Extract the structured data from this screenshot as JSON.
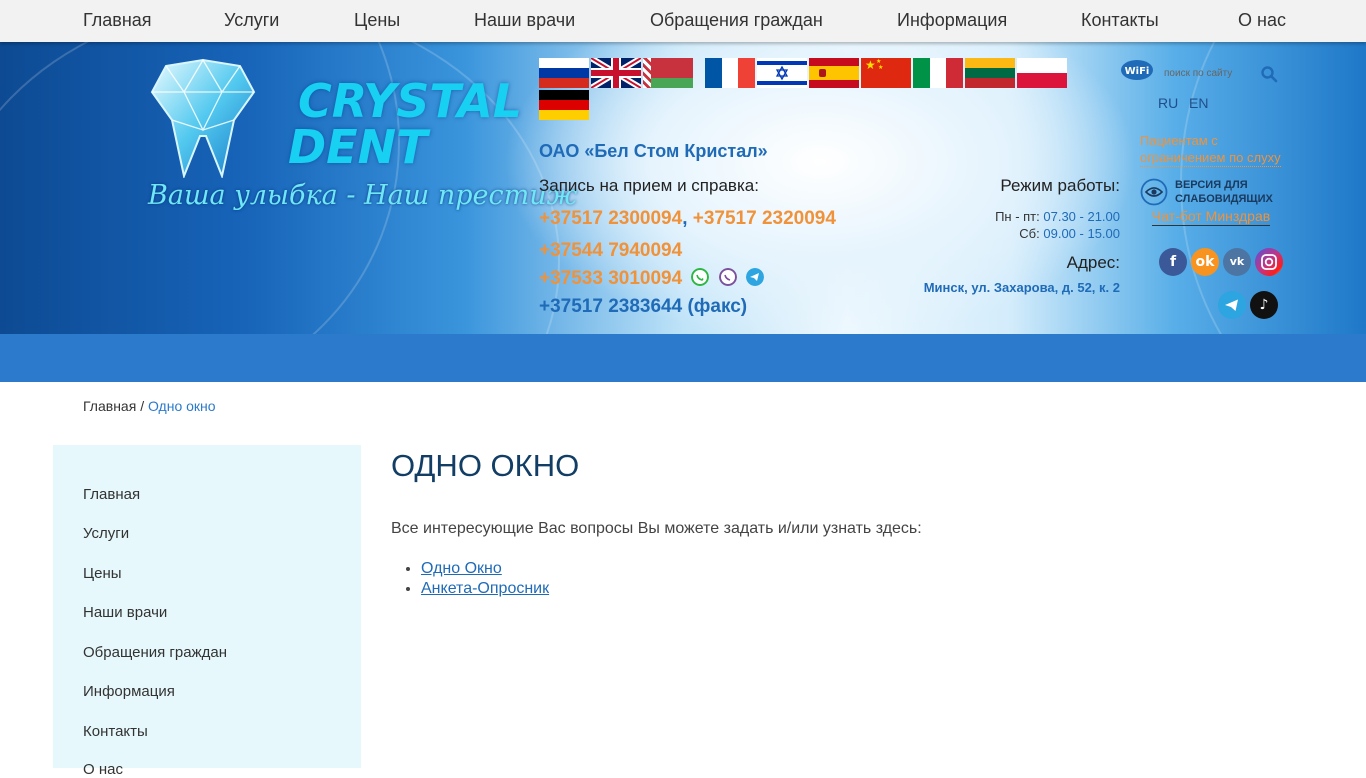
{
  "topnav": [
    "Главная",
    "Услуги",
    "Цены",
    "Наши врачи",
    "Обращения граждан",
    "Информация",
    "Контакты",
    "О нас"
  ],
  "logo": {
    "line1": "CRYSTAL",
    "line2": "DENT",
    "slogan": "Ваша улыбка - Наш престиж"
  },
  "header": {
    "company": "ОАО «Бел Стом Кристал»",
    "record_label": "Запись на прием и справка:",
    "phone1": "+37517 2300094",
    "phone_sep": ",",
    "phone2": "+37517 2320094",
    "phone3": "+37544 7940094",
    "phone4": "+37533 3010094",
    "fax": "+37517 2383644 (факс)",
    "hours_label": "Режим работы:",
    "weekdays_label": "Пн - пт:",
    "weekdays_value": "07.30 - 21.00",
    "saturday_label": "Сб:",
    "saturday_value": "09.00 - 15.00",
    "address_label": "Адрес:",
    "address": "Минск, ул. Захарова, д. 52, к. 2",
    "wifi": "WiFi",
    "search_placeholder": "поиск по сайту",
    "lang_ru": "RU",
    "lang_en": "EN",
    "hearing_line1": "Пациентам с",
    "hearing_line2": "ограничением по слуху",
    "vision_line1": "ВЕРСИЯ ДЛЯ",
    "vision_line2": "СЛАБОВИДЯЩИХ",
    "chatbot": "Чат-бот Минздрав"
  },
  "flags": [
    "russia",
    "united-kingdom",
    "belarus",
    "france",
    "israel",
    "spain",
    "china",
    "italy",
    "lithuania",
    "poland",
    "germany"
  ],
  "social": [
    "facebook",
    "odnoklassniki",
    "vk",
    "instagram",
    "telegram",
    "tiktok"
  ],
  "breadcrumb": {
    "home": "Главная",
    "sep": "/",
    "current": "Одно окно"
  },
  "sidebar": [
    "Главная",
    "Услуги",
    "Цены",
    "Наши врачи",
    "Обращения граждан",
    "Информация",
    "Контакты",
    "О нас"
  ],
  "main": {
    "title": "ОДНО ОКНО",
    "intro": "Все интересующие Вас вопросы Вы можете задать и/или узнать здесь:",
    "links": [
      "Одно Окно",
      "Анкета-Опросник"
    ]
  },
  "colors": {
    "accent_blue": "#2b7acb",
    "phone_orange": "#f0923a",
    "title_navy": "#123e66",
    "sidebar_bg": "#e6f8fc"
  }
}
